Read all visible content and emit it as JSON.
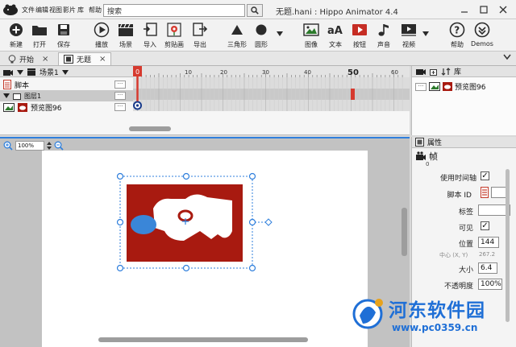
{
  "menu": {
    "items": [
      "文件",
      "编辑",
      "视图",
      "影片",
      "库",
      "帮助"
    ]
  },
  "search": {
    "placeholder": "搜索"
  },
  "window": {
    "title": "无题.hani : Hippo Animator 4.4"
  },
  "toolbar": {
    "new": "新建",
    "open": "打开",
    "save": "保存",
    "play": "播放",
    "scene": "场景",
    "import": "导入",
    "clipart": "剪贴画",
    "export": "导出",
    "triangle": "三角形",
    "circle": "圆形",
    "image": "图像",
    "text": "文本",
    "button": "按钮",
    "sound": "声音",
    "video": "视频",
    "help": "帮助",
    "demos": "Demos"
  },
  "tabs": {
    "start": "开始",
    "untitled": "无题"
  },
  "timeline": {
    "scene_label": "场景1",
    "rows": {
      "script": "脚本",
      "layer": "图层1",
      "symbol": "预览图96"
    },
    "current_frame": "0",
    "ruler_labels": [
      "10",
      "20",
      "30",
      "40",
      "50",
      "60"
    ]
  },
  "library": {
    "title": "库",
    "items": [
      "预览图96"
    ]
  },
  "stage": {
    "zoom": "100%"
  },
  "properties": {
    "title": "属性",
    "subtitle": "帧",
    "frame_index": "0",
    "use_timeline": "使用时间轴",
    "script_id": "脚本 ID",
    "tag": "标签",
    "visible": "可见",
    "position": "位置",
    "position_x": "144",
    "center_label": "中心 (X, Y)",
    "center_value": "267.2",
    "size": "大小",
    "size_value": "6.4",
    "opacity": "不透明度",
    "opacity_value": "100%"
  },
  "watermark": {
    "site_name": "河东软件园",
    "site_url": "www.pc0359.cn"
  },
  "colors": {
    "accent_blue": "#2f7fdc",
    "playhead_red": "#d63a2f",
    "image_red": "#a81a10",
    "blob_blue": "#3a86d8",
    "watermark_blue": "#1f6fd6"
  }
}
